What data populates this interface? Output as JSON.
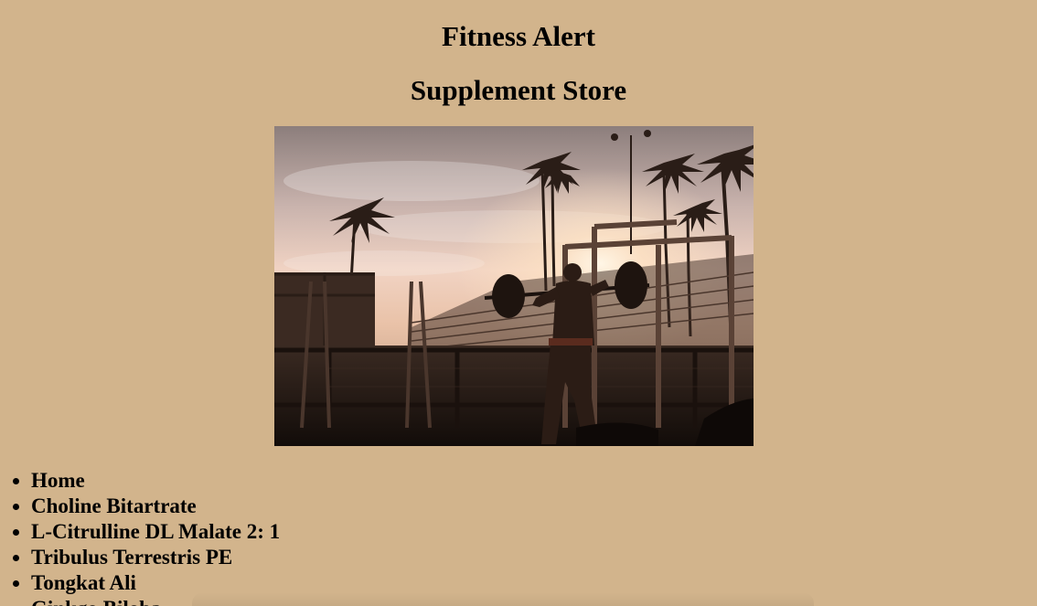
{
  "header": {
    "title": "Fitness Alert",
    "subtitle": "Supplement Store"
  },
  "hero_image": {
    "alt": "Man lifting a barbell at an outdoor gym among palm trees at sunset"
  },
  "nav": {
    "items": [
      {
        "label": "Home"
      },
      {
        "label": "Choline Bitartrate"
      },
      {
        "label": "L-Citrulline DL Malate 2: 1"
      },
      {
        "label": "Tribulus Terrestris PE"
      },
      {
        "label": "Tongkat Ali"
      },
      {
        "label": "Ginkgo Biloba"
      }
    ]
  },
  "colors": {
    "background": "#d2b48c"
  }
}
